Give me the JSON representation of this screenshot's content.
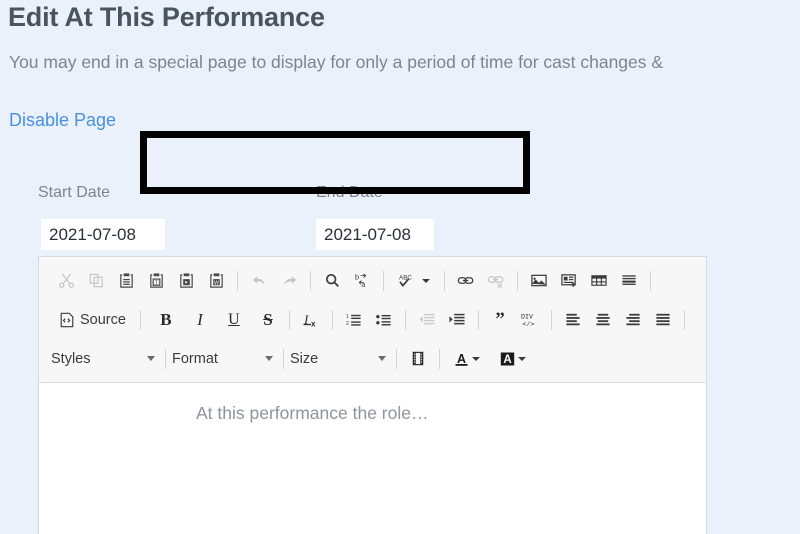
{
  "header": {
    "title": "Edit At This Performance",
    "subtitle": "You may end in a special page to display for only a period of time for cast changes &",
    "disable_link": "Disable Page"
  },
  "form": {
    "start_date": {
      "label": "Start Date",
      "value": "2021-07-08"
    },
    "end_date": {
      "label": "End Date",
      "value": "2021-07-08"
    }
  },
  "editor": {
    "placeholder": "At this performance the role…",
    "source_label": "Source",
    "toolbar": {
      "row1": [
        {
          "name": "cut-icon",
          "title": "Cut",
          "disabled": true
        },
        {
          "name": "copy-icon",
          "title": "Copy",
          "disabled": true
        },
        {
          "name": "paste-icon",
          "title": "Paste",
          "disabled": false
        },
        {
          "name": "paste-as-plain-text-icon",
          "title": "Paste as plain text",
          "disabled": false
        },
        {
          "name": "paste-from-word-icon",
          "title": "Paste from Word",
          "disabled": false
        },
        {
          "name": "paste-from-word-doc-icon",
          "title": "Paste from Word",
          "disabled": false
        },
        {
          "name": "undo-icon",
          "title": "Undo",
          "disabled": true
        },
        {
          "name": "redo-icon",
          "title": "Redo",
          "disabled": true
        },
        {
          "name": "find-icon",
          "title": "Find",
          "disabled": false
        },
        {
          "name": "replace-icon",
          "title": "Replace",
          "disabled": false
        },
        {
          "name": "spell-check-icon",
          "title": "Spell Check As You Type",
          "disabled": false
        },
        {
          "name": "link-icon",
          "title": "Link",
          "disabled": false
        },
        {
          "name": "unlink-icon",
          "title": "Unlink",
          "disabled": true
        },
        {
          "name": "image-icon",
          "title": "Image",
          "disabled": false
        },
        {
          "name": "insert-template-icon",
          "title": "Templates",
          "disabled": false
        },
        {
          "name": "table-icon",
          "title": "Table",
          "disabled": false
        },
        {
          "name": "horizontal-rule-icon",
          "title": "Horizontal Line",
          "disabled": false
        }
      ],
      "row2": [
        {
          "name": "source-button",
          "title": "Source",
          "disabled": false
        },
        {
          "name": "bold-icon",
          "title": "Bold",
          "label": "B",
          "disabled": false
        },
        {
          "name": "italic-icon",
          "title": "Italic",
          "label": "I",
          "disabled": false
        },
        {
          "name": "underline-icon",
          "title": "Underline",
          "label": "U",
          "disabled": false
        },
        {
          "name": "strikethrough-icon",
          "title": "Strikethrough",
          "label": "S",
          "disabled": false
        },
        {
          "name": "remove-format-icon",
          "title": "Remove Format",
          "disabled": false
        },
        {
          "name": "numbered-list-icon",
          "title": "Insert/Remove Numbered List",
          "disabled": false
        },
        {
          "name": "bulleted-list-icon",
          "title": "Insert/Remove Bulleted List",
          "disabled": false
        },
        {
          "name": "outdent-icon",
          "title": "Decrease Indent",
          "disabled": true
        },
        {
          "name": "indent-icon",
          "title": "Increase Indent",
          "disabled": false
        },
        {
          "name": "blockquote-icon",
          "title": "Block Quote",
          "disabled": false
        },
        {
          "name": "div-container-icon",
          "title": "Create Div Container",
          "label": "DIV",
          "disabled": false
        },
        {
          "name": "align-left-icon",
          "title": "Align Left",
          "disabled": false
        },
        {
          "name": "align-center-icon",
          "title": "Center",
          "disabled": false
        },
        {
          "name": "align-right-icon",
          "title": "Align Right",
          "disabled": false
        },
        {
          "name": "justify-icon",
          "title": "Justify",
          "disabled": false
        }
      ],
      "row3": [
        {
          "name": "styles-dropdown",
          "label": "Styles"
        },
        {
          "name": "format-dropdown",
          "label": "Format"
        },
        {
          "name": "size-dropdown",
          "label": "Size"
        },
        {
          "name": "media-embed-icon",
          "title": "Media Embed"
        },
        {
          "name": "text-color-icon",
          "title": "Text Color",
          "label": "A"
        },
        {
          "name": "background-color-icon",
          "title": "Background Color",
          "label": "A"
        }
      ]
    }
  },
  "colors": {
    "page_background": "#eaf1fa",
    "link": "#4a90e2",
    "title_text": "#49545f",
    "muted_text": "#7a8591",
    "toolbar_background": "#f7f7f7",
    "editor_background": "#ffffff",
    "highlight_border": "#000000"
  }
}
